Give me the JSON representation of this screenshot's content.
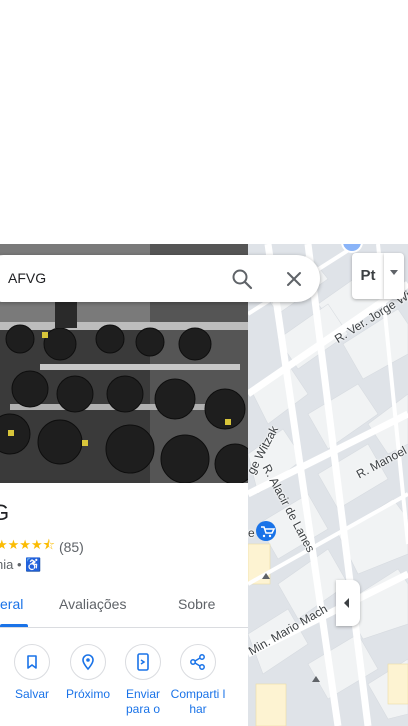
{
  "search": {
    "query": "AFVG"
  },
  "layer_button": {
    "label": "Pt"
  },
  "place": {
    "title": "G",
    "stars": "★★★★⯪",
    "review_count": "(85)",
    "category": "nia •",
    "accessibility_icon": "♿"
  },
  "tabs": [
    "eral",
    "Avaliações",
    "Sobre"
  ],
  "actions": [
    {
      "label": "Salvar",
      "icon": "bookmark-icon"
    },
    {
      "label": "Próximo",
      "icon": "nearby-icon"
    },
    {
      "label": "Enviar para o smartph",
      "icon": "send-to-phone-icon"
    },
    {
      "label": "Compartilhar",
      "label_display": "Comparti lhar",
      "icon": "share-icon"
    }
  ],
  "map": {
    "streets": {
      "jorge": "R. Ver. Jorge Wi",
      "witzak": "ge Witzak",
      "manoel": "R. Manoel",
      "alacir": "R. Alacir de Lanes",
      "mario": "Min. Mario Mach",
      "e_fragment": "e"
    }
  },
  "colors": {
    "accent": "#1a73e8",
    "star": "#fbbc04",
    "map_bg": "#e8eaed",
    "block": "#f1f3f4",
    "road": "#ffffff",
    "highlight_block": "#fdf3d2"
  }
}
